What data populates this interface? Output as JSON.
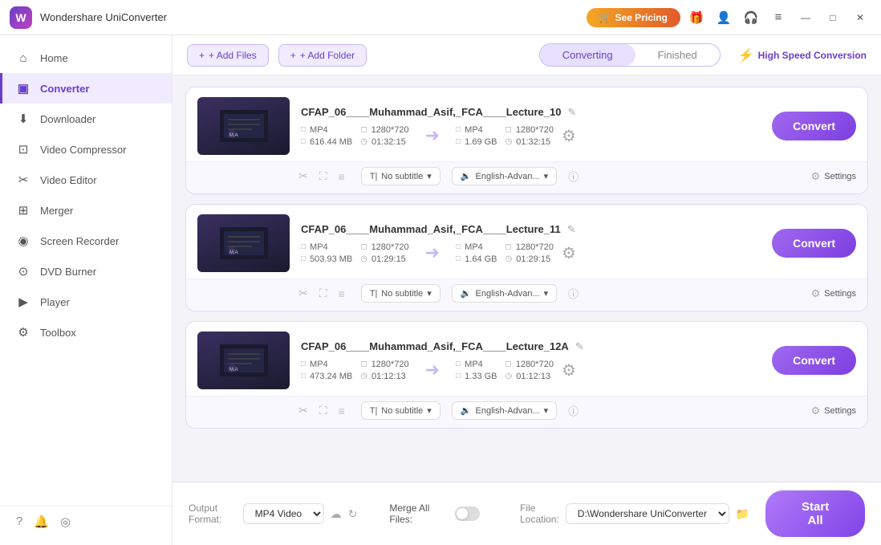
{
  "app": {
    "logo_text": "W",
    "title": "Wondershare UniConverter"
  },
  "titlebar": {
    "pricing_label": "See Pricing",
    "pricing_icon": "🛒",
    "gift_icon": "🎁",
    "minimize_label": "—",
    "maximize_label": "□",
    "close_label": "✕",
    "menu_icon": "≡"
  },
  "sidebar": {
    "items": [
      {
        "id": "home",
        "label": "Home",
        "icon": "⌂"
      },
      {
        "id": "converter",
        "label": "Converter",
        "icon": "▣",
        "active": true
      },
      {
        "id": "downloader",
        "label": "Downloader",
        "icon": "⬇"
      },
      {
        "id": "video-compressor",
        "label": "Video Compressor",
        "icon": "⊡"
      },
      {
        "id": "video-editor",
        "label": "Video Editor",
        "icon": "✂"
      },
      {
        "id": "merger",
        "label": "Merger",
        "icon": "⊞"
      },
      {
        "id": "screen-recorder",
        "label": "Screen Recorder",
        "icon": "◉"
      },
      {
        "id": "dvd-burner",
        "label": "DVD Burner",
        "icon": "⊙"
      },
      {
        "id": "player",
        "label": "Player",
        "icon": "▶"
      },
      {
        "id": "toolbox",
        "label": "Toolbox",
        "icon": "⚙"
      }
    ],
    "bottom_icons": [
      "?",
      "🔔",
      "◎"
    ]
  },
  "toolbar": {
    "add_file_label": "+ Add Files",
    "add_folder_label": "+ Add Folder",
    "converting_tab": "Converting",
    "finished_tab": "Finished",
    "speed_label": "High Speed Conversion"
  },
  "files": [
    {
      "id": 1,
      "name": "CFAP_06____Muhammad_Asif,_FCA____Lecture_10",
      "src_format": "MP4",
      "src_resolution": "1280*720",
      "src_size": "616.44 MB",
      "src_duration": "01:32:15",
      "dst_format": "MP4",
      "dst_resolution": "1280*720",
      "dst_size": "1.69 GB",
      "dst_duration": "01:32:15",
      "subtitle": "No subtitle",
      "audio": "English-Advan...",
      "convert_label": "Convert",
      "settings_label": "Settings"
    },
    {
      "id": 2,
      "name": "CFAP_06____Muhammad_Asif,_FCA____Lecture_11",
      "src_format": "MP4",
      "src_resolution": "1280*720",
      "src_size": "503.93 MB",
      "src_duration": "01:29:15",
      "dst_format": "MP4",
      "dst_resolution": "1280*720",
      "dst_size": "1.64 GB",
      "dst_duration": "01:29:15",
      "subtitle": "No subtitle",
      "audio": "English-Advan...",
      "convert_label": "Convert",
      "settings_label": "Settings"
    },
    {
      "id": 3,
      "name": "CFAP_06____Muhammad_Asif,_FCA____Lecture_12A",
      "src_format": "MP4",
      "src_resolution": "1280*720",
      "src_size": "473.24 MB",
      "src_duration": "01:12:13",
      "dst_format": "MP4",
      "dst_resolution": "1280*720",
      "dst_size": "1.33 GB",
      "dst_duration": "01:12:13",
      "subtitle": "No subtitle",
      "audio": "English-Advan...",
      "convert_label": "Convert",
      "settings_label": "Settings"
    }
  ],
  "bottom": {
    "output_format_label": "Output Format:",
    "output_format_value": "MP4 Video",
    "file_location_label": "File Location:",
    "file_location_value": "D:\\Wondershare UniConverter",
    "merge_label": "Merge All Files:",
    "start_all_label": "Start All"
  }
}
